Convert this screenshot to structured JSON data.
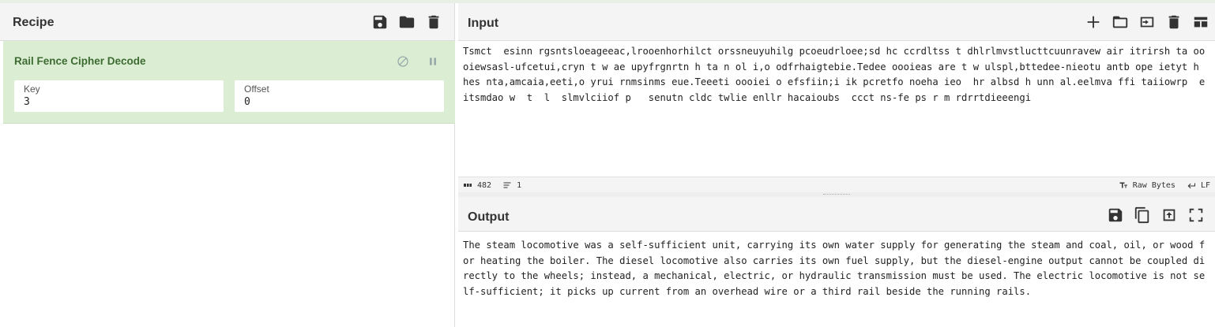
{
  "recipe": {
    "title": "Recipe",
    "operation": {
      "name": "Rail Fence Cipher Decode",
      "key_label": "Key",
      "key_value": "3",
      "offset_label": "Offset",
      "offset_value": "0"
    }
  },
  "input": {
    "title": "Input",
    "text": "Tsmct  esinn rgsntsloeageeac,lrooenhorhilct orssneuyuhilg pcoeudrloee;sd hc ccrdltss t dhlrlmvstlucttcuunravew air itrirsh ta oooiewsasl-ufcetui,cryn t w ae upyfrgnrtn h ta n ol i,o odfrhaigtebie.Tedee oooieas are t w ulspl,bttedee-nieotu antb ope ietyt h hes nta,amcaia,eeti,o yrui rnmsinms eue.Teeeti oooiei o efsfiin;i ik pcretfo noeha ieo  hr albsd h unn al.eelmva ffi taiiowrp  eitsmdao w  t  l  slmvlciiof p   senutn cldc twlie enllr hacaioubs  ccct ns-fe ps r m rdrrtdieeengi",
    "status": {
      "length": "482",
      "lines": "1",
      "encoding": "Raw Bytes",
      "eol": "LF"
    }
  },
  "output": {
    "title": "Output",
    "text": "The steam locomotive was a self-sufficient unit, carrying its own water supply for generating the steam and coal, oil, or wood for heating the boiler. The diesel locomotive also carries its own fuel supply, but the diesel-engine output cannot be coupled directly to the wheels; instead, a mechanical, electric, or hydraulic transmission must be used. The electric locomotive is not self-sufficient; it picks up current from an overhead wire or a third rail beside the running rails."
  },
  "colors": {
    "operation_bg": "#dbeed3",
    "operation_text": "#3d6b32",
    "header_bg": "#f4f4f4"
  }
}
